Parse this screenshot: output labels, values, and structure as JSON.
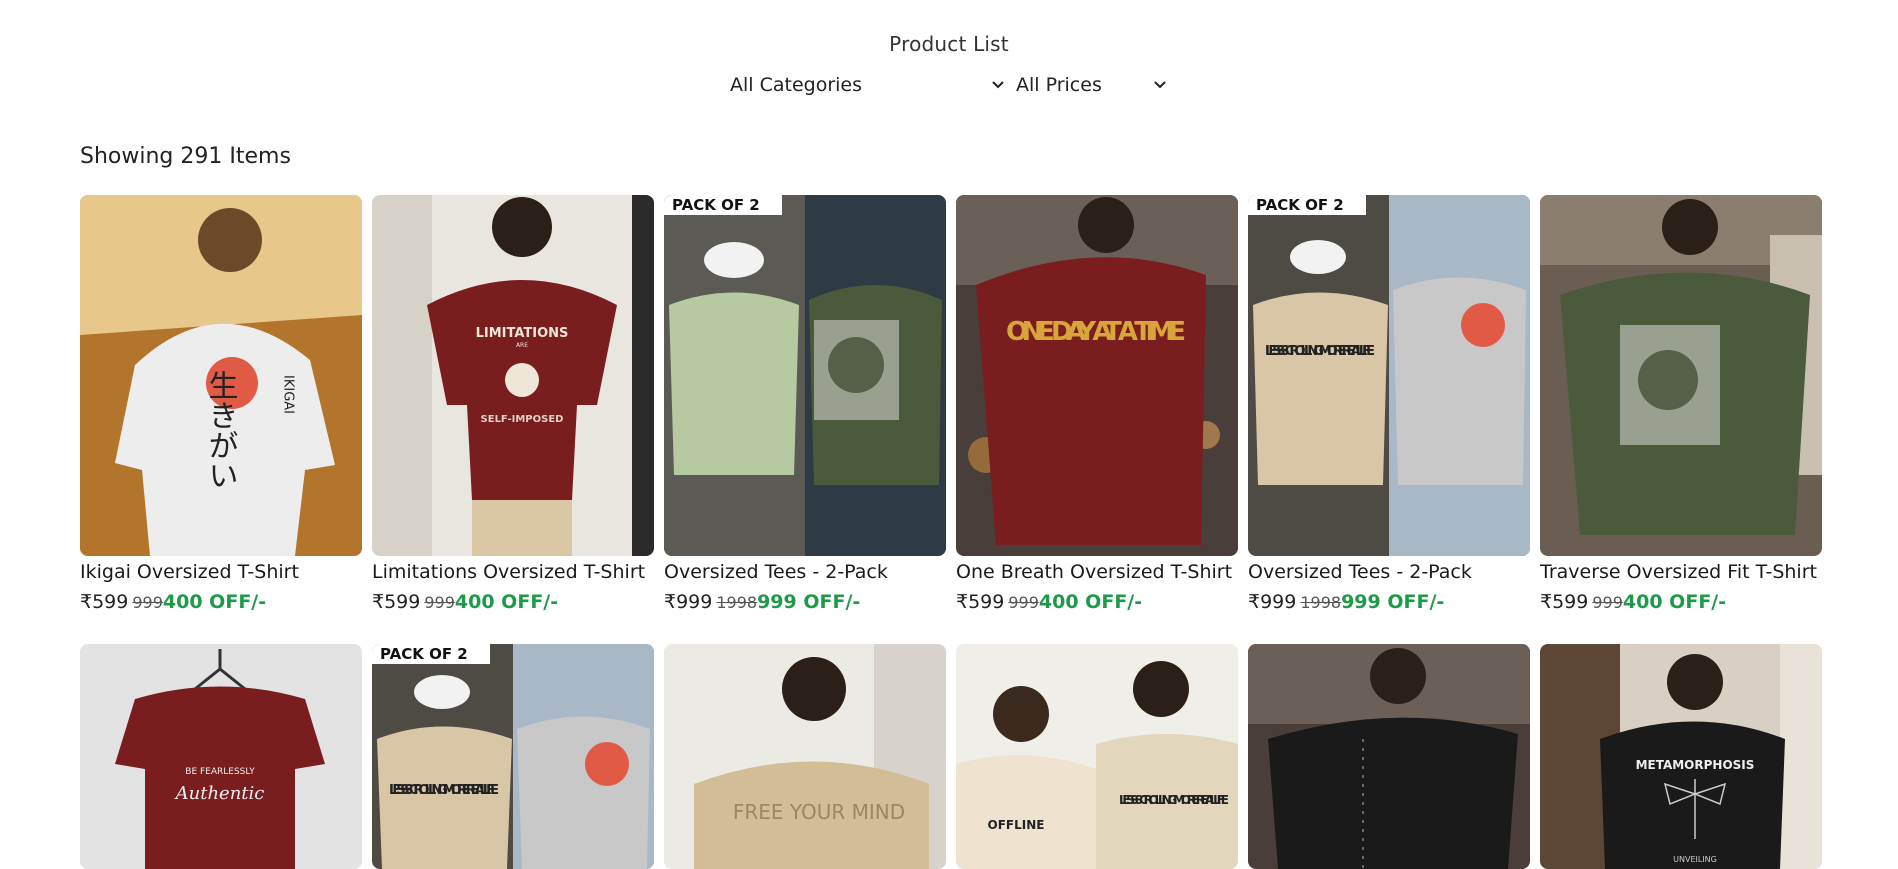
{
  "header": {
    "title": "Product List"
  },
  "filters": {
    "category": "All Categories",
    "price": "All Prices"
  },
  "results": {
    "showing": "Showing 291 Items"
  },
  "products_row1": [
    {
      "name": "Ikigai Oversized T-Shirt",
      "price": "₹599",
      "mrp": "999",
      "off": "400 OFF/-"
    },
    {
      "name": "Limitations Oversized T-Shirt",
      "price": "₹599",
      "mrp": "999",
      "off": "400 OFF/-"
    },
    {
      "name": "Oversized Tees - 2-Pack",
      "price": "₹999",
      "mrp": "1998",
      "off": "999 OFF/-"
    },
    {
      "name": "One Breath Oversized T-Shirt",
      "price": "₹599",
      "mrp": "999",
      "off": "400 OFF/-"
    },
    {
      "name": "Oversized Tees - 2-Pack",
      "price": "₹999",
      "mrp": "1998",
      "off": "999 OFF/-"
    },
    {
      "name": "Traverse Oversized Fit T-Shirt",
      "price": "₹599",
      "mrp": "999",
      "off": "400 OFF/-"
    }
  ],
  "images_text": {
    "pack": "PACK OF 2",
    "limitations": "LIMITATIONS",
    "are": "ARE",
    "self_imposed": "SELF-IMPOSED",
    "ikigai_vertical": "IKIGAI",
    "ikigai_jp": "生きがい",
    "one_day": "ONE DAY AT A TIME",
    "less_scrolling": "LESS SCROLLING MORE REAL LIFE",
    "offline": "OFFLINE",
    "free_your_mind": "FREE YOUR MIND",
    "metamorphosis": "METAMORPHOSIS",
    "unveiling": "UNVEILING",
    "authentic": "Authentic",
    "be_fearlessly": "BE FEARLESSLY"
  },
  "colors": {
    "discount_green": "#1f9a4a",
    "maroon": "#7a1d1f",
    "olive": "#4a5a3a",
    "sage": "#b7c9a0",
    "beige": "#d8c6a6"
  }
}
